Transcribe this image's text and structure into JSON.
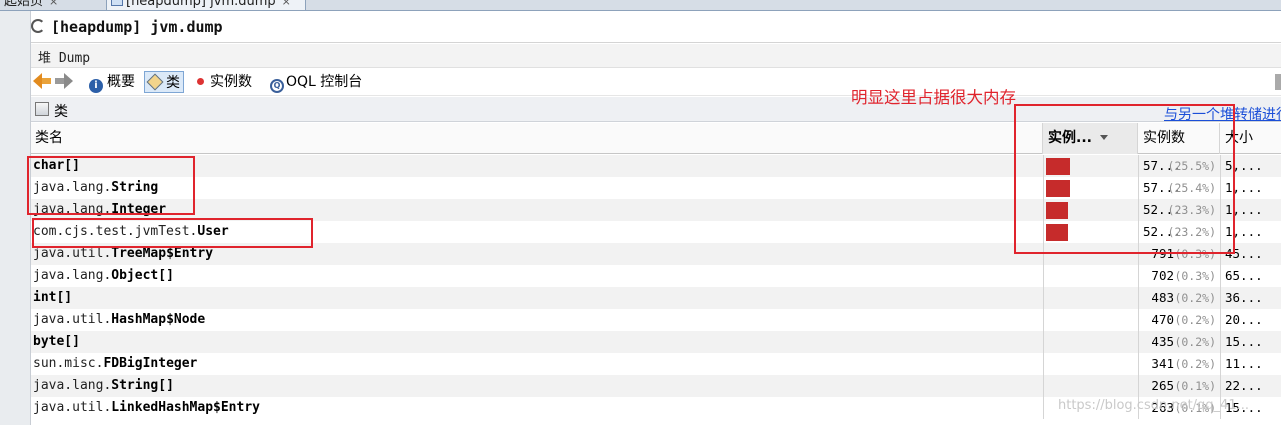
{
  "doc_tabs": [
    {
      "label": "起始页",
      "close": "×"
    },
    {
      "label": "[heapdump] jvm.dump",
      "close": "×"
    }
  ],
  "window": {
    "title": "[heapdump] jvm.dump"
  },
  "subtitle": "堆 Dump",
  "toolbar": {
    "summary_label": "概要",
    "classes_label": "类",
    "instances_label": "实例数",
    "oql_label": "OQL 控制台"
  },
  "section": {
    "title": "类",
    "compare_link": "与另一个堆转储进行比较"
  },
  "table": {
    "columns": {
      "name": "类名",
      "bar": "实例...",
      "count": "实例数",
      "size": "大小"
    },
    "rows": [
      {
        "name_prefix": "",
        "name_bold": "char[]",
        "count": "57...",
        "pct": "(25.5%)",
        "size": "5,...",
        "bar_fraction": 1.0
      },
      {
        "name_prefix": "java.lang.",
        "name_bold": "String",
        "count": "57...",
        "pct": "(25.4%)",
        "size": "1,...",
        "bar_fraction": 1.0
      },
      {
        "name_prefix": "java.lang.",
        "name_bold": "Integer",
        "count": "52...",
        "pct": "(23.3%)",
        "size": "1,...",
        "bar_fraction": 0.91
      },
      {
        "name_prefix": "com.cjs.test.jvmTest.",
        "name_bold": "User",
        "count": "52...",
        "pct": "(23.2%)",
        "size": "1,...",
        "bar_fraction": 0.91
      },
      {
        "name_prefix": "java.util.",
        "name_bold": "TreeMap$Entry",
        "count": "791",
        "pct": "(0.3%)",
        "size": "45...",
        "bar_fraction": 0
      },
      {
        "name_prefix": "java.lang.",
        "name_bold": "Object[]",
        "count": "702",
        "pct": "(0.3%)",
        "size": "65...",
        "bar_fraction": 0
      },
      {
        "name_prefix": "",
        "name_bold": "int[]",
        "count": "483",
        "pct": "(0.2%)",
        "size": "36...",
        "bar_fraction": 0
      },
      {
        "name_prefix": "java.util.",
        "name_bold": "HashMap$Node",
        "count": "470",
        "pct": "(0.2%)",
        "size": "20...",
        "bar_fraction": 0
      },
      {
        "name_prefix": "",
        "name_bold": "byte[]",
        "count": "435",
        "pct": "(0.2%)",
        "size": "15...",
        "bar_fraction": 0
      },
      {
        "name_prefix": "sun.misc.",
        "name_bold": "FDBigInteger",
        "count": "341",
        "pct": "(0.2%)",
        "size": "11...",
        "bar_fraction": 0
      },
      {
        "name_prefix": "java.lang.",
        "name_bold": "String[]",
        "count": "265",
        "pct": "(0.1%)",
        "size": "22...",
        "bar_fraction": 0
      },
      {
        "name_prefix": "java.util.",
        "name_bold": "LinkedHashMap$Entry",
        "count": "263",
        "pct": "(0.1%)",
        "size": "15...",
        "bar_fraction": 0
      }
    ]
  },
  "annotation": {
    "note": "明显这里占据很大内存",
    "color": "#e0242d"
  },
  "watermark": "https://blog.csdn.net/qq_41..."
}
